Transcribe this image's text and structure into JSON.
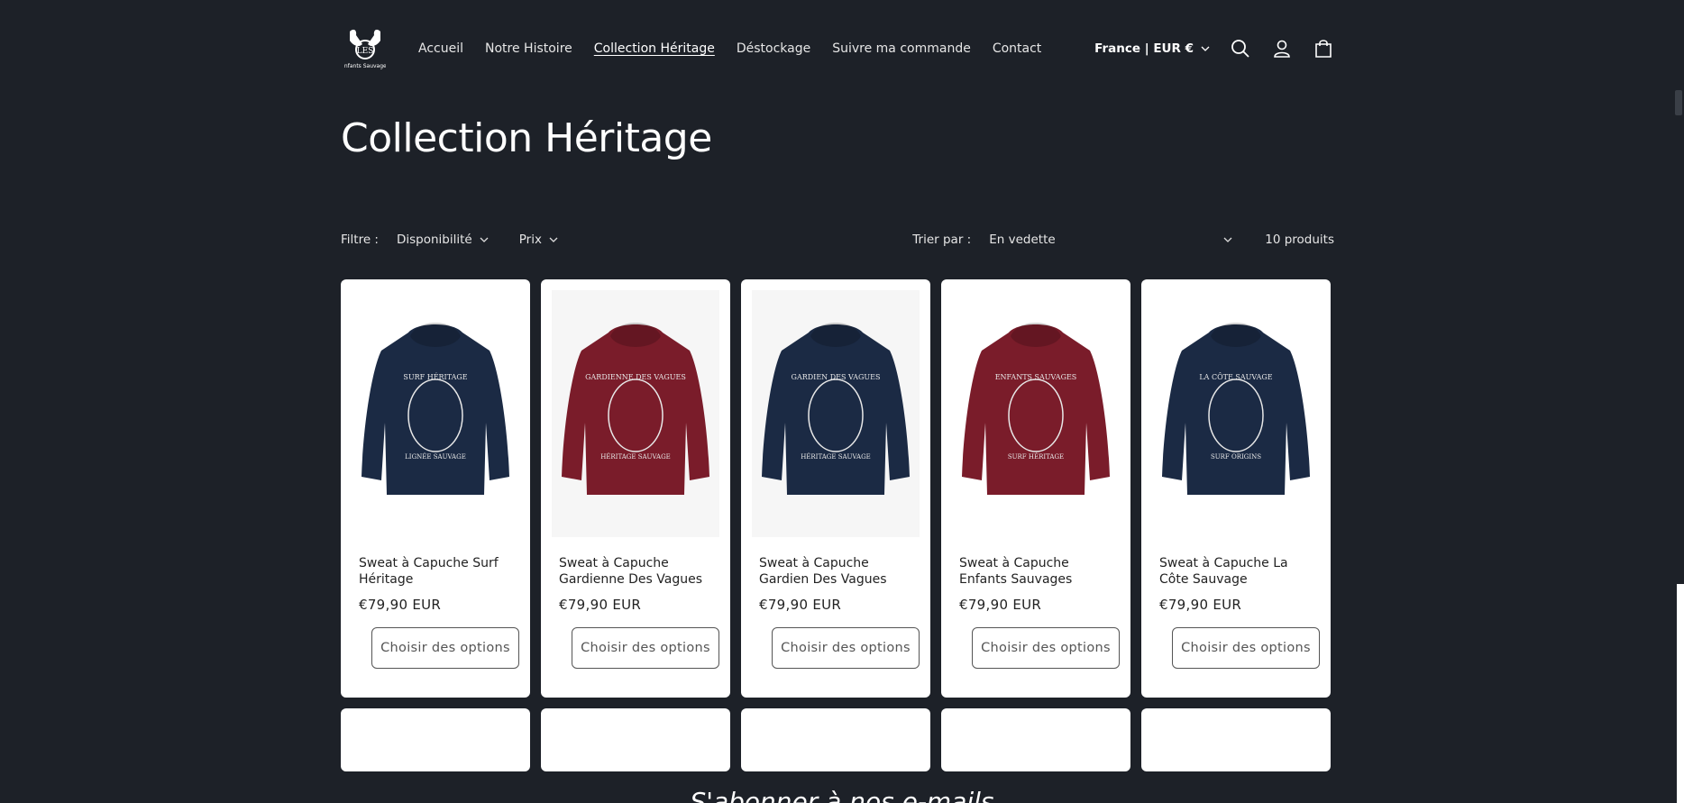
{
  "header": {
    "logo_name": "Les Enfants Sauvages logo",
    "nav": [
      "Accueil",
      "Notre Histoire",
      "Collection Héritage",
      "Déstockage",
      "Suivre ma commande",
      "Contact"
    ],
    "active_nav": "Collection Héritage",
    "country": "France | EUR €"
  },
  "page": {
    "title": "Collection Héritage"
  },
  "filters": {
    "label": "Filtre :",
    "availability": "Disponibilité",
    "price": "Prix",
    "sort_label": "Trier par :",
    "sort_value": "En vedette",
    "count": "10 produits"
  },
  "products": [
    {
      "name": "Sweat à Capuche Surf Héritage",
      "price": "€79,90 EUR",
      "button": "Choisir des options",
      "color": "#1b2a44",
      "print_top": "SURF HÉRITAGE",
      "print_bottom": "LIGNÉE SAUVAGE"
    },
    {
      "name": "Sweat à Capuche Gardienne Des Vagues",
      "price": "€79,90 EUR",
      "button": "Choisir des options",
      "color": "#7a1c2a",
      "print_top": "GARDIENNE DES VAGUES",
      "print_bottom": "HÉRITAGE SAUVAGE"
    },
    {
      "name": "Sweat à Capuche Gardien Des Vagues",
      "price": "€79,90 EUR",
      "button": "Choisir des options",
      "color": "#1b2a44",
      "print_top": "GARDIEN DES VAGUES",
      "print_bottom": "HÉRITAGE SAUVAGE"
    },
    {
      "name": "Sweat à Capuche Enfants Sauvages",
      "price": "€79,90 EUR",
      "button": "Choisir des options",
      "color": "#7a1c2a",
      "print_top": "ENFANTS SAUVAGES",
      "print_bottom": "SURF HÉRITAGE"
    },
    {
      "name": "Sweat à Capuche La Côte Sauvage",
      "price": "€79,90 EUR",
      "button": "Choisir des options",
      "color": "#1b2a44",
      "print_top": "LA CÔTE SAUVAGE",
      "print_bottom": "SURF ORIGINS"
    }
  ],
  "newsletter": {
    "title": "S'abonner à nos e-mails"
  }
}
